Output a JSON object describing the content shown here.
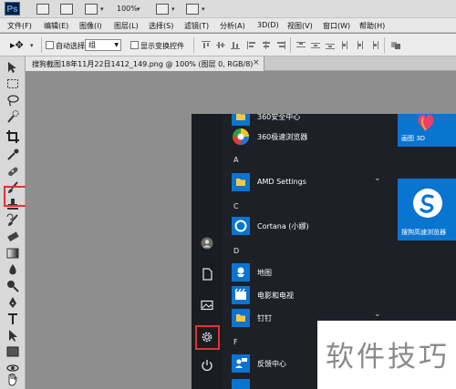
{
  "app": {
    "logo": "Ps",
    "zoom": "100%"
  },
  "menu": [
    "文件(F)",
    "编辑(E)",
    "图像(I)",
    "图层(L)",
    "选择(S)",
    "滤镜(T)",
    "分析(A)",
    "3D(D)",
    "视图(V)",
    "窗口(W)",
    "帮助(H)"
  ],
  "options": {
    "auto_select_label": "自动选择:",
    "auto_select_value": "组",
    "show_transform_label": "显示变换控件"
  },
  "document": {
    "tab_title": "搜狗截图18年11月22日1412_149.png @ 100% (图层 0, RGB/8)",
    "close_glyph": "×"
  },
  "toolbox": {
    "highlighted_tool": "crop-tool",
    "highlight_color": "#e03333"
  },
  "start_menu": {
    "groups": [
      {
        "letter": "A",
        "apps": [
          {
            "label": "AMD Settings",
            "icon": "folder-icon",
            "expandable": true
          }
        ]
      },
      {
        "letter": "C",
        "apps": [
          {
            "label": "Cortana (小娜)",
            "icon": "cortana-icon",
            "expandable": false
          }
        ]
      },
      {
        "letter": "D",
        "apps": [
          {
            "label": "地图",
            "icon": "map-icon",
            "expandable": false
          },
          {
            "label": "电影和电视",
            "icon": "film-icon",
            "expandable": false
          },
          {
            "label": "钉钉",
            "icon": "folder-icon",
            "expandable": true
          }
        ]
      },
      {
        "letter": "F",
        "apps": [
          {
            "label": "反馈中心",
            "icon": "feedback-icon",
            "expandable": false
          }
        ]
      }
    ],
    "top_apps": [
      {
        "label": "360安全中心",
        "icon": "folder-icon"
      },
      {
        "label": "360极速浏览器",
        "icon": "browser-360-icon"
      }
    ],
    "tiles": [
      {
        "label": "画图 3D",
        "icon": "paint3d-icon"
      },
      {
        "label": "搜狗高速浏览器",
        "icon": "sogou-icon"
      }
    ],
    "rail": [
      "user-icon",
      "document-icon",
      "pictures-icon",
      "settings-icon",
      "power-icon"
    ],
    "highlighted_rail": "settings-icon",
    "expand_glyph": "⌄"
  },
  "watermark": {
    "text": "软件技巧"
  },
  "colors": {
    "start_bg": "#1d2027",
    "tile_blue": "#0a74d1",
    "highlight_red": "#e03333"
  }
}
